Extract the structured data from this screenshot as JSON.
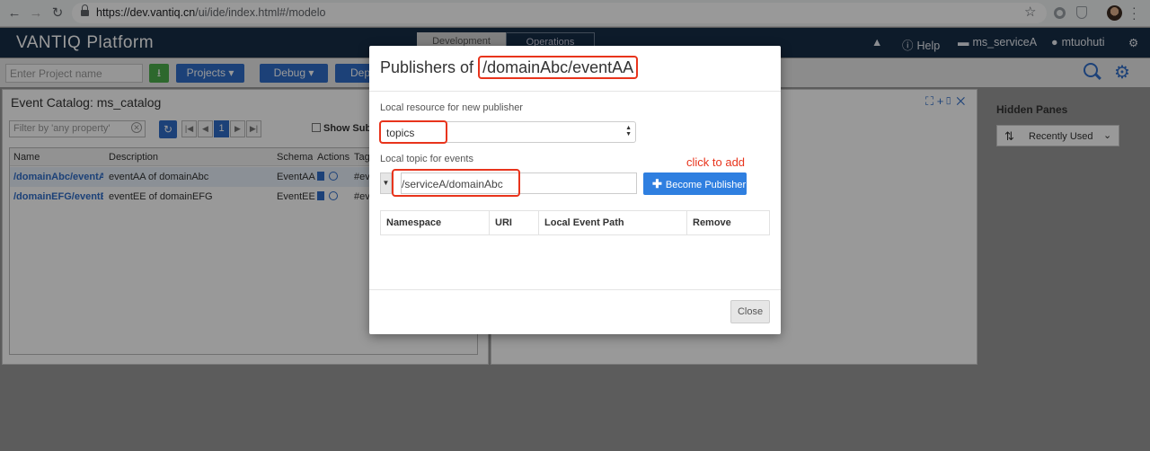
{
  "browser": {
    "url_prefix": "https://dev.vantiq.cn",
    "url_path": "/ui/ide/index.html#/modelo"
  },
  "header": {
    "logo": "VANTIQ",
    "platform": "Platform",
    "tabs": [
      "Development",
      "Operations"
    ],
    "help": "Help",
    "namespace": "ms_serviceA",
    "user": "mtuohuti"
  },
  "toolbar": {
    "project_placeholder": "Enter Project name",
    "projects_label": "Projects ▾",
    "debug_label": "Debug ▾",
    "deploy_label": "Depl"
  },
  "catalog": {
    "title": "Event Catalog: ms_catalog",
    "filter_placeholder": "Filter by 'any property'",
    "page": "1",
    "show_sub_label": "Show Subs",
    "columns": [
      "Name",
      "Description",
      "Schema",
      "Actions",
      "Tags"
    ],
    "rows": [
      {
        "name": "/domainAbc/eventAA",
        "description": "eventAA of domainAbc",
        "schema": "EventAA",
        "tags": "#eve"
      },
      {
        "name": "/domainEFG/eventEE",
        "description": "eventEE of domainEFG",
        "schema": "EventEE",
        "tags": "#eve"
      }
    ]
  },
  "hidden_panes": {
    "title": "Hidden Panes",
    "sort_label": "Recently Used"
  },
  "modal": {
    "title_prefix": "Publishers of",
    "title_path": "/domainAbc/eventAA",
    "resource_label": "Local resource for new publisher",
    "resource_value": "topics",
    "topic_label": "Local topic for events",
    "topic_value": "/serviceA/domainAbc",
    "annotation": "click to add",
    "publish_button": "Become Publisher",
    "columns": [
      "Namespace",
      "URI",
      "Local Event Path",
      "Remove"
    ],
    "close_button": "Close"
  },
  "colors": {
    "brand_dark": "#172d47",
    "primary": "#2f6dc9",
    "highlight": "#e8341c"
  }
}
